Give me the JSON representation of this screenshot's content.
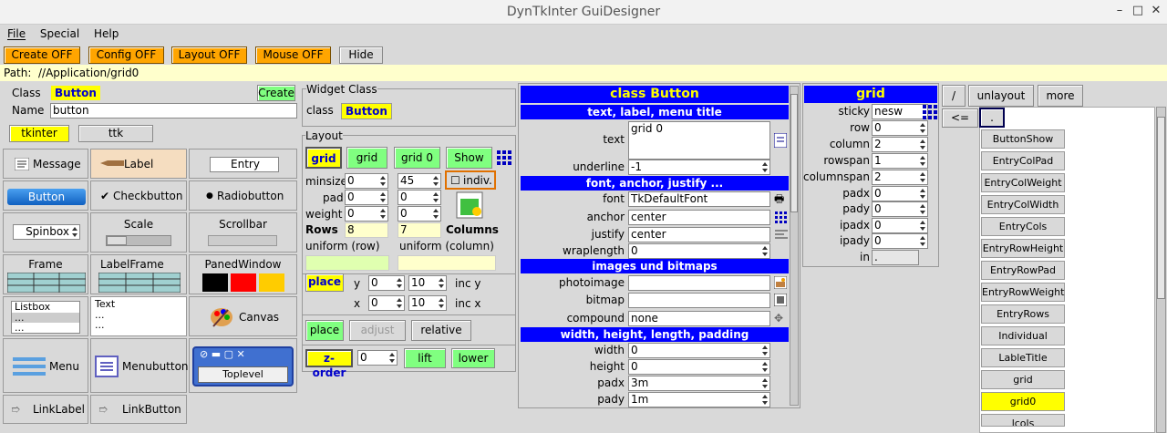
{
  "window": {
    "title": "DynTkInter GuiDesigner",
    "min": "–",
    "max": "□",
    "close": "✕"
  },
  "menu": [
    "File",
    "Special",
    "Help"
  ],
  "toolbar": [
    "Create OFF",
    "Config OFF",
    "Layout OFF",
    "Mouse OFF",
    "Hide"
  ],
  "path": {
    "label": "Path:",
    "value": "//Application/grid0"
  },
  "left": {
    "class_label": "Class",
    "class_value": "Button",
    "create": "Create",
    "name_label": "Name",
    "name_value": "button",
    "tab_tkinter": "tkinter",
    "tab_ttk": "ttk",
    "widgets": [
      "Message",
      "Label",
      "Entry",
      "Button",
      "Checkbutton",
      "Radiobutton",
      "Spinbox",
      "Scale",
      "Scrollbar",
      "Frame",
      "LabelFrame",
      "PanedWindow",
      "Listbox",
      "Text",
      "Canvas",
      "Menu",
      "Menubutton",
      "Toplevel",
      "LinkLabel",
      "LinkButton"
    ],
    "listbox_lines": [
      "...",
      "..."
    ],
    "text_lines": [
      "...",
      "..."
    ]
  },
  "widget_class": {
    "title": "Widget Class",
    "class_label": "class",
    "class_value": "Button"
  },
  "layout": {
    "title": "Layout",
    "buttons": [
      "grid",
      "grid",
      "grid 0",
      "Show"
    ],
    "rows": [
      {
        "label": "minsize",
        "a": "0",
        "b": "45"
      },
      {
        "label": "pad",
        "a": "0",
        "b": "0"
      },
      {
        "label": "weight",
        "a": "0",
        "b": "0"
      }
    ],
    "indiv": "indiv.",
    "rows_label": "Rows",
    "rows_value": "8",
    "cols_value": "7",
    "columns_label": "Columns",
    "uniform_row": "uniform (row)",
    "uniform_col": "uniform (column)",
    "place": "place",
    "y_label": "y",
    "y_a": "0",
    "y_b": "10",
    "inc_y": "inc y",
    "x_label": "x",
    "x_a": "0",
    "x_b": "10",
    "inc_x": "inc x",
    "place_btn": "place",
    "adjust": "adjust",
    "relative": "relative",
    "zorder": "z-order",
    "zorder_val": "0",
    "lift": "lift",
    "lower": "lower"
  },
  "config": {
    "title": "class Button",
    "sec1": "text, label, menu title",
    "text_label": "text",
    "text_value": "grid 0",
    "underline_label": "underline",
    "underline_value": "-1",
    "sec2": "font, anchor, justify ...",
    "font_label": "font",
    "font_value": "TkDefaultFont",
    "anchor_label": "anchor",
    "anchor_value": "center",
    "justify_label": "justify",
    "justify_value": "center",
    "wrap_label": "wraplength",
    "wrap_value": "0",
    "sec3": "images und bitmaps",
    "photo_label": "photoimage",
    "bitmap_label": "bitmap",
    "compound_label": "compound",
    "compound_value": "none",
    "sec4": "width, height, length, padding",
    "width_label": "width",
    "width_value": "0",
    "height_label": "height",
    "height_value": "0",
    "padx_label": "padx",
    "padx_value": "3m",
    "pady_label": "pady",
    "pady_value": "1m"
  },
  "grid": {
    "title": "grid",
    "rows": [
      {
        "label": "sticky",
        "value": "nesw"
      },
      {
        "label": "row",
        "value": "0"
      },
      {
        "label": "column",
        "value": "2"
      },
      {
        "label": "rowspan",
        "value": "1"
      },
      {
        "label": "columnspan",
        "value": "2"
      },
      {
        "label": "padx",
        "value": "0"
      },
      {
        "label": "pady",
        "value": "0"
      },
      {
        "label": "ipadx",
        "value": "0"
      },
      {
        "label": "ipady",
        "value": "0"
      },
      {
        "label": "in",
        "value": "."
      }
    ]
  },
  "tree": {
    "slash": "/",
    "unlayout": "unlayout",
    "more": "more",
    "back": "<=",
    "dot": ".",
    "items": [
      "ButtonShow",
      "EntryColPad",
      "EntryColWeight",
      "EntryColWidth",
      "EntryCols",
      "EntryRowHeight",
      "EntryRowPad",
      "EntryRowWeight",
      "EntryRows",
      "Individual",
      "LableTitle",
      "grid",
      "grid0",
      "lcols"
    ]
  }
}
